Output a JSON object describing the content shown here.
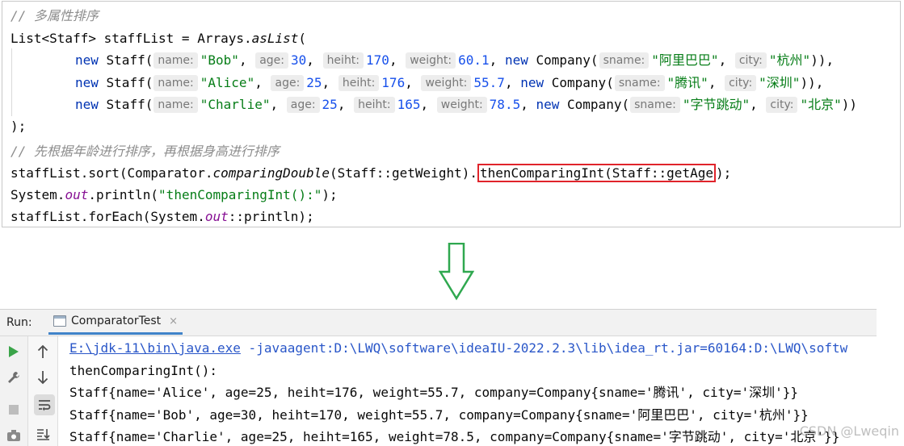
{
  "editor": {
    "comment1": "// 多属性排序",
    "line_list_a": "List<Staff> staffList = Arrays.",
    "line_list_method": "asList",
    "line_list_b": "(",
    "new_kw": "new",
    "staff_ctor": " Staff(",
    "company_ctor": " Company(",
    "hint_name": "name:",
    "hint_age": "age:",
    "hint_heiht": "heiht:",
    "hint_weight": "weight:",
    "hint_sname": "sname:",
    "hint_city": "city:",
    "comma": ",",
    "staff": [
      {
        "name": "\"Bob\"",
        "age": "30",
        "heiht": "170",
        "weight": "60.1",
        "sname": "\"阿里巴巴\"",
        "city": "\"杭州\"",
        "end": ")),"
      },
      {
        "name": "\"Alice\"",
        "age": "25",
        "heiht": "176",
        "weight": "55.7",
        "sname": "\"腾讯\"",
        "city": "\"深圳\"",
        "end": ")),"
      },
      {
        "name": "\"Charlie\"",
        "age": "25",
        "heiht": "165",
        "weight": "78.5",
        "sname": "\"字节跳动\"",
        "city": "\"北京\"",
        "end": "))"
      }
    ],
    "close_paren": ");",
    "comment2": "// 先根据年龄进行排序，再根据身高进行排序",
    "sort_a": "staffList.sort(Comparator.",
    "sort_method": "comparingDouble",
    "sort_b": "(Staff::getWeight).",
    "sort_highlight": "thenComparingInt(Staff::getAge",
    "sort_c": ");",
    "print_a": "System.",
    "print_field": "out",
    "print_b": ".println(",
    "print_str": "\"thenComparingInt():\"",
    "print_c": ");",
    "foreach_a": "staffList.forEach(System.",
    "foreach_field": "out",
    "foreach_b": "::println);"
  },
  "run_panel": {
    "label": "Run:",
    "tab_title": "ComparatorTest",
    "tab_close": "×",
    "cmd_exe": "E:\\jdk-11\\bin\\java.exe",
    "cmd_args": " -javaagent:D:\\LWQ\\software\\ideaIU-2022.2.3\\lib\\idea_rt.jar=60164:D:\\LWQ\\softw",
    "output": [
      "thenComparingInt():",
      "Staff{name='Alice', age=25, heiht=176, weight=55.7, company=Company{sname='腾讯', city='深圳'}}",
      "Staff{name='Bob', age=30, heiht=170, weight=55.7, company=Company{sname='阿里巴巴', city='杭州'}}",
      "Staff{name='Charlie', age=25, heiht=165, weight=78.5, company=Company{sname='字节跳动', city='北京'}}"
    ]
  },
  "watermark": "CSDN @Lweqin",
  "colors": {
    "keyword": "#0033b3",
    "string": "#067d17",
    "number": "#1750eb",
    "comment": "#8c8c8c",
    "highlight_box": "#e0242b",
    "arrow": "#2fa84f",
    "run_icon": "#3aa449",
    "link": "#2956c8"
  }
}
